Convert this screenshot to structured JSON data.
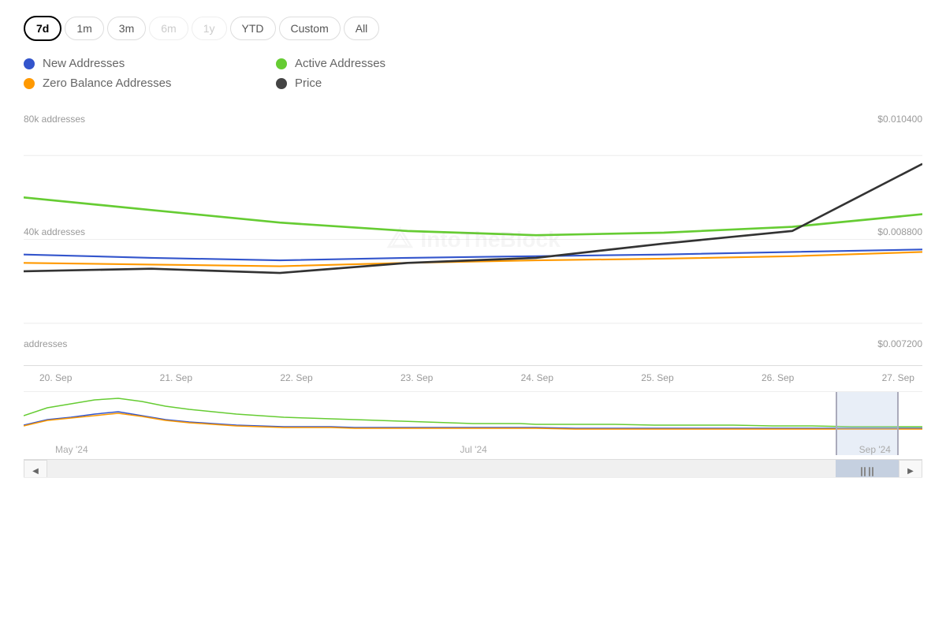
{
  "timeRange": {
    "buttons": [
      {
        "label": "7d",
        "value": "7d",
        "state": "active"
      },
      {
        "label": "1m",
        "value": "1m",
        "state": "normal"
      },
      {
        "label": "3m",
        "value": "3m",
        "state": "normal"
      },
      {
        "label": "6m",
        "value": "6m",
        "state": "disabled"
      },
      {
        "label": "1y",
        "value": "1y",
        "state": "disabled"
      },
      {
        "label": "YTD",
        "value": "ytd",
        "state": "normal"
      },
      {
        "label": "Custom",
        "value": "custom",
        "state": "normal"
      },
      {
        "label": "All",
        "value": "all",
        "state": "normal"
      }
    ]
  },
  "legend": {
    "items": [
      {
        "label": "New Addresses",
        "color": "#3355cc",
        "id": "new-addresses"
      },
      {
        "label": "Active Addresses",
        "color": "#66cc33",
        "id": "active-addresses"
      },
      {
        "label": "Zero Balance Addresses",
        "color": "#ff9900",
        "id": "zero-balance"
      },
      {
        "label": "Price",
        "color": "#444444",
        "id": "price"
      }
    ]
  },
  "yAxisLeft": {
    "labels": [
      "80k addresses",
      "40k addresses",
      "addresses"
    ]
  },
  "yAxisRight": {
    "labels": [
      "$0.010400",
      "$0.008800",
      "$0.007200"
    ]
  },
  "xAxis": {
    "labels": [
      "20. Sep",
      "21. Sep",
      "22. Sep",
      "23. Sep",
      "24. Sep",
      "25. Sep",
      "26. Sep",
      "27. Sep"
    ]
  },
  "navigator": {
    "labels": [
      "May '24",
      "Jul '24",
      "Sep '24"
    ]
  },
  "watermark": {
    "text": "IntoTheBlock"
  }
}
